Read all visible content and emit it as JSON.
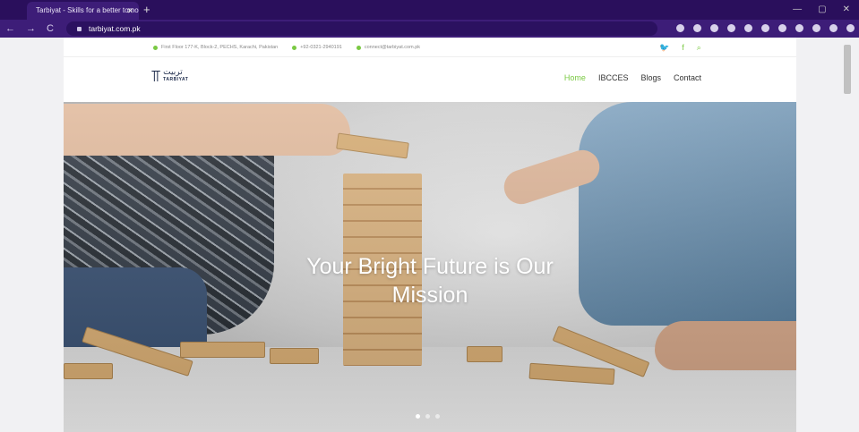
{
  "browser": {
    "tab_title": "Tarbiyat - Skills for a better tomo",
    "tab_close": "✕",
    "new_tab": "+",
    "nav": {
      "back": "←",
      "forward": "→",
      "reload": "C"
    },
    "url": "tarbiyat.com.pk",
    "window_controls": {
      "minimize": "—",
      "maximize": "▢",
      "close": "✕"
    }
  },
  "topbar": {
    "address": "First Floor 177-K, Block-2, PECHS, Karachi, Pakistan",
    "phone": "+92-0321-2940191",
    "email": "connect@tarbiyat.com.pk",
    "twitter_glyph": "🐦",
    "facebook_glyph": "f",
    "search_glyph": "⌕"
  },
  "logo": {
    "mark": "⫪",
    "arabic": "تربیت",
    "english": "TARBIYAT"
  },
  "menu": [
    {
      "label": "Home",
      "active": true
    },
    {
      "label": "IBCCES",
      "active": false
    },
    {
      "label": "Blogs",
      "active": false
    },
    {
      "label": "Contact",
      "active": false
    }
  ],
  "hero": {
    "title_line1": "Your Bright Future is Our",
    "title_line2": "Mission",
    "slide_count": 3,
    "active_slide": 1
  },
  "colors": {
    "accent": "#7ac943",
    "chrome": "#3d1d78"
  }
}
